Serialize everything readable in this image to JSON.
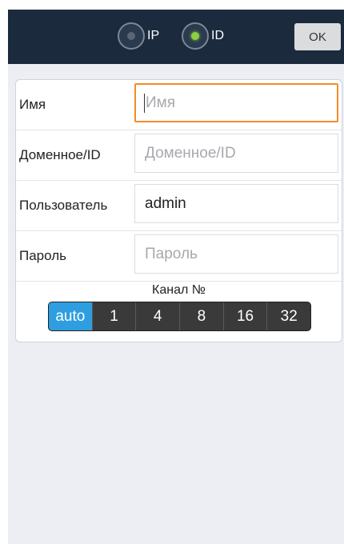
{
  "header": {
    "radio_ip": {
      "label": "IP",
      "checked": false
    },
    "radio_id": {
      "label": "ID",
      "checked": true
    },
    "ok_label": "OK"
  },
  "form": {
    "name": {
      "label": "Имя",
      "value": "",
      "placeholder": "Имя",
      "focused": true
    },
    "domain": {
      "label": "Доменное/ID",
      "value": "",
      "placeholder": "Доменное/ID"
    },
    "user": {
      "label": "Пользователь",
      "value": "admin",
      "placeholder": ""
    },
    "password": {
      "label": "Пароль",
      "value": "",
      "placeholder": "Пароль"
    }
  },
  "channel": {
    "title": "Канал №",
    "options": [
      "auto",
      "1",
      "4",
      "8",
      "16",
      "32"
    ],
    "selected": "auto"
  },
  "colors": {
    "topbar": "#1c2a3d",
    "focus_border": "#f28c28",
    "active_segment": "#2f9ee0",
    "radio_checked": "#8ad03e"
  }
}
